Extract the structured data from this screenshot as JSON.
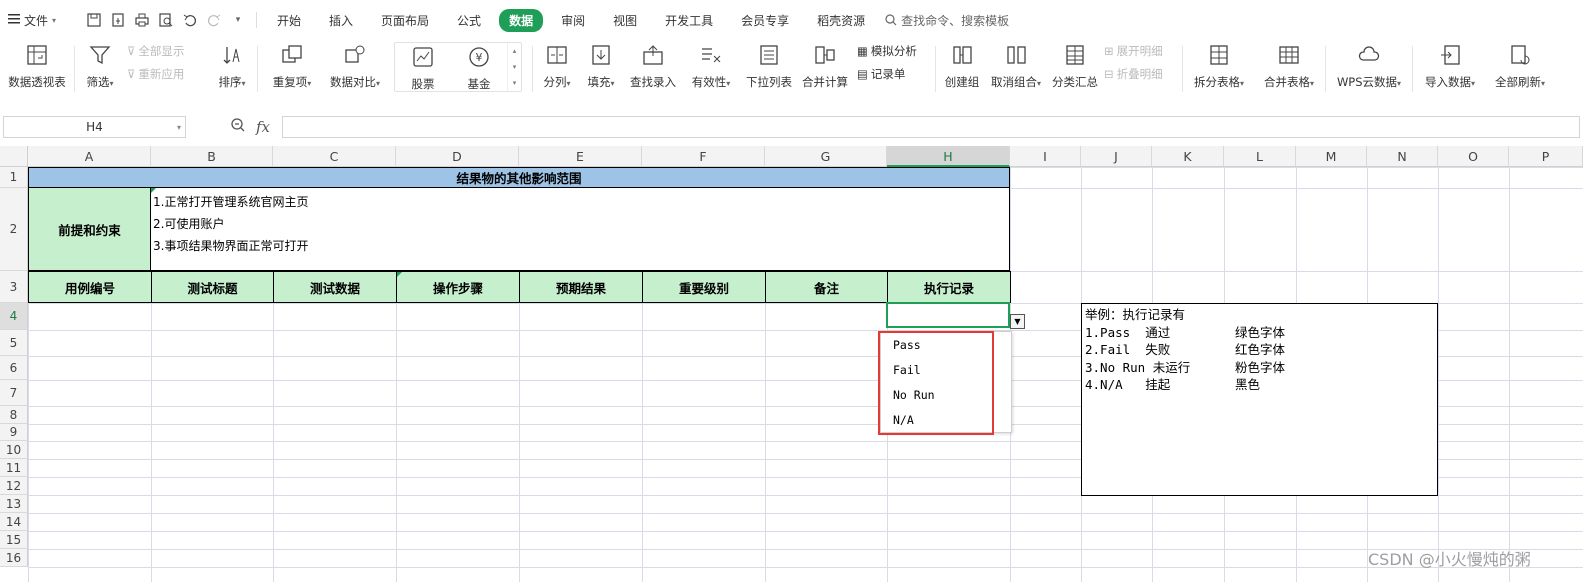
{
  "menu": {
    "file_label": "文件",
    "tabs": [
      "开始",
      "插入",
      "页面布局",
      "公式",
      "数据",
      "审阅",
      "视图",
      "开发工具",
      "会员专享",
      "稻壳资源"
    ],
    "active_tab": "数据",
    "search_placeholder": "查找命令、搜索模板"
  },
  "ribbon": {
    "pivot": "数据透视表",
    "filter": "筛选",
    "show_all": "全部显示",
    "reapply": "重新应用",
    "sort": "排序",
    "duplicates": "重复项",
    "compare": "数据对比",
    "stocks": "股票",
    "fund": "基金",
    "split": "分列",
    "fill": "填充",
    "lookup": "查找录入",
    "validity": "有效性",
    "dropdown_list": "下拉列表",
    "consolidate": "合并计算",
    "whatif": "模拟分析",
    "record_sheet": "记录单",
    "create_group": "创建组",
    "ungroup": "取消组合",
    "subtotal": "分类汇总",
    "expand": "展开明细",
    "collapse": "折叠明细",
    "split_table": "拆分表格",
    "merge_table": "合并表格",
    "wps_cloud": "WPS云数据",
    "import": "导入数据",
    "refresh_all": "全部刷新"
  },
  "formula_bar": {
    "name_box": "H4",
    "fx": "fx",
    "formula": ""
  },
  "columns": [
    "A",
    "B",
    "C",
    "D",
    "E",
    "F",
    "G",
    "H",
    "I",
    "J",
    "K",
    "L",
    "M",
    "N",
    "O",
    "P"
  ],
  "selected_column": "H",
  "rows": [
    "1",
    "2",
    "3",
    "4",
    "5",
    "6",
    "7",
    "8",
    "9",
    "10",
    "11",
    "12",
    "13",
    "14",
    "15",
    "16"
  ],
  "selected_row": "4",
  "sheet": {
    "title": "结果物的其他影响范围",
    "premise_label": "前提和约束",
    "premise_lines": [
      "1.正常打开管理系统官网主页",
      "2.可使用账户",
      "3.事项结果物界面正常可打开"
    ],
    "headers": [
      "用例编号",
      "测试标题",
      "测试数据",
      "操作步骤",
      "预期结果",
      "重要级别",
      "备注",
      "执行记录"
    ]
  },
  "dropdown": {
    "options": [
      "Pass",
      "Fail",
      "No Run",
      "N/A"
    ]
  },
  "note": {
    "title": "举例：执行记录有",
    "lines": [
      {
        "left": "1.Pass  通过",
        "right": "绿色字体"
      },
      {
        "left": "2.Fail  失败",
        "right": "红色字体"
      },
      {
        "left": "3.No Run 未运行",
        "right": "粉色字体"
      },
      {
        "left": "4.N/A   挂起",
        "right": "黑色"
      }
    ]
  },
  "watermark": "CSDN @小火慢炖的粥",
  "colors": {
    "accent": "#1f9e58",
    "title_fill": "#9dc3e6",
    "header_fill": "#c6efce",
    "highlight_box": "#e53935"
  }
}
